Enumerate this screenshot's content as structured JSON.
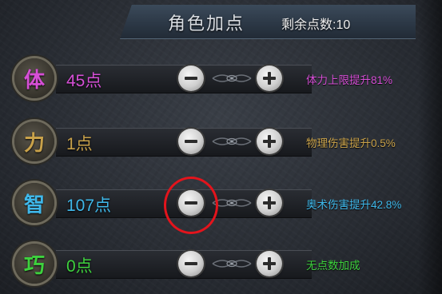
{
  "header": {
    "title": "角色加点",
    "remaining_label": "剩余点数:",
    "remaining_value": "10"
  },
  "stats": [
    {
      "badge": "体",
      "value": "45点",
      "effect": "体力上限提升81%",
      "color": "#d64fd6",
      "minus_icon": "minus-icon",
      "plus_icon": "plus-icon"
    },
    {
      "badge": "力",
      "value": "1点",
      "effect": "物理伤害提升0.5%",
      "color": "#c9a24a",
      "minus_icon": "minus-icon",
      "plus_icon": "plus-icon"
    },
    {
      "badge": "智",
      "value": "107点",
      "effect": "奥术伤害提升42.8%",
      "color": "#3fb8ea",
      "minus_icon": "minus-icon",
      "plus_icon": "plus-icon"
    },
    {
      "badge": "巧",
      "value": "0点",
      "effect": "无点数加成",
      "color": "#3ed23e",
      "minus_icon": "minus-icon",
      "plus_icon": "plus-icon"
    }
  ],
  "highlight": {
    "color": "#e3141c",
    "target": "stats.2.minus"
  }
}
